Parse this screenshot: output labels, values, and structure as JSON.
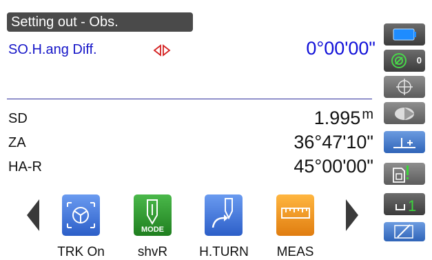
{
  "screen": {
    "title": "Setting out - Obs."
  },
  "setting_out": {
    "label": "SO.H.ang Diff.",
    "value": "0°00'00\""
  },
  "measurements": [
    {
      "label": "SD",
      "value": "1.995",
      "unit": "m"
    },
    {
      "label": "ZA",
      "value": "36°47'10\""
    },
    {
      "label": "HA-R",
      "value": "45°00'00\""
    }
  ],
  "status_bar": {
    "battery_icon": "battery-icon",
    "prism_icon": "prism-target-icon",
    "prism_constant": "0",
    "items": [
      "crosshair-icon",
      "laser-pointer-icon",
      "tilt-compensation-icon",
      "sd-card-icon",
      "input-mode-icon",
      "edit-pen-icon"
    ],
    "input_mode_number": "1"
  },
  "softkeys": [
    {
      "label": "TRK On",
      "icon": "tracking-icon"
    },
    {
      "label": "shvR",
      "icon": "plumb-mode-icon",
      "tag": "MODE"
    },
    {
      "label": "H.TURN",
      "icon": "horizontal-turn-icon"
    },
    {
      "label": "MEAS",
      "icon": "measure-tape-icon"
    }
  ],
  "colors": {
    "accent_blue": "#1010d8",
    "title_bg": "#4a4a4a",
    "arrow_red": "#d42020",
    "key_blue": "#3a6fd8",
    "key_green": "#2f9e2f",
    "key_orange": "#f09a1e"
  }
}
